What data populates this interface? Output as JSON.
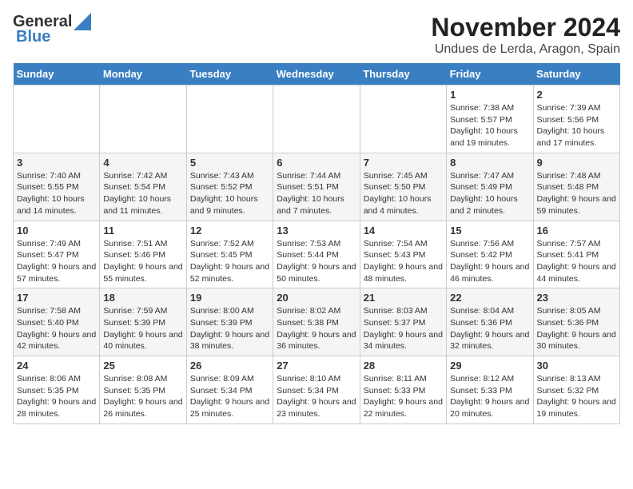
{
  "logo": {
    "line1": "General",
    "line2": "Blue"
  },
  "title": "November 2024",
  "subtitle": "Undues de Lerda, Aragon, Spain",
  "weekdays": [
    "Sunday",
    "Monday",
    "Tuesday",
    "Wednesday",
    "Thursday",
    "Friday",
    "Saturday"
  ],
  "weeks": [
    [
      {
        "day": "",
        "info": ""
      },
      {
        "day": "",
        "info": ""
      },
      {
        "day": "",
        "info": ""
      },
      {
        "day": "",
        "info": ""
      },
      {
        "day": "",
        "info": ""
      },
      {
        "day": "1",
        "info": "Sunrise: 7:38 AM\nSunset: 5:57 PM\nDaylight: 10 hours and 19 minutes."
      },
      {
        "day": "2",
        "info": "Sunrise: 7:39 AM\nSunset: 5:56 PM\nDaylight: 10 hours and 17 minutes."
      }
    ],
    [
      {
        "day": "3",
        "info": "Sunrise: 7:40 AM\nSunset: 5:55 PM\nDaylight: 10 hours and 14 minutes."
      },
      {
        "day": "4",
        "info": "Sunrise: 7:42 AM\nSunset: 5:54 PM\nDaylight: 10 hours and 11 minutes."
      },
      {
        "day": "5",
        "info": "Sunrise: 7:43 AM\nSunset: 5:52 PM\nDaylight: 10 hours and 9 minutes."
      },
      {
        "day": "6",
        "info": "Sunrise: 7:44 AM\nSunset: 5:51 PM\nDaylight: 10 hours and 7 minutes."
      },
      {
        "day": "7",
        "info": "Sunrise: 7:45 AM\nSunset: 5:50 PM\nDaylight: 10 hours and 4 minutes."
      },
      {
        "day": "8",
        "info": "Sunrise: 7:47 AM\nSunset: 5:49 PM\nDaylight: 10 hours and 2 minutes."
      },
      {
        "day": "9",
        "info": "Sunrise: 7:48 AM\nSunset: 5:48 PM\nDaylight: 9 hours and 59 minutes."
      }
    ],
    [
      {
        "day": "10",
        "info": "Sunrise: 7:49 AM\nSunset: 5:47 PM\nDaylight: 9 hours and 57 minutes."
      },
      {
        "day": "11",
        "info": "Sunrise: 7:51 AM\nSunset: 5:46 PM\nDaylight: 9 hours and 55 minutes."
      },
      {
        "day": "12",
        "info": "Sunrise: 7:52 AM\nSunset: 5:45 PM\nDaylight: 9 hours and 52 minutes."
      },
      {
        "day": "13",
        "info": "Sunrise: 7:53 AM\nSunset: 5:44 PM\nDaylight: 9 hours and 50 minutes."
      },
      {
        "day": "14",
        "info": "Sunrise: 7:54 AM\nSunset: 5:43 PM\nDaylight: 9 hours and 48 minutes."
      },
      {
        "day": "15",
        "info": "Sunrise: 7:56 AM\nSunset: 5:42 PM\nDaylight: 9 hours and 46 minutes."
      },
      {
        "day": "16",
        "info": "Sunrise: 7:57 AM\nSunset: 5:41 PM\nDaylight: 9 hours and 44 minutes."
      }
    ],
    [
      {
        "day": "17",
        "info": "Sunrise: 7:58 AM\nSunset: 5:40 PM\nDaylight: 9 hours and 42 minutes."
      },
      {
        "day": "18",
        "info": "Sunrise: 7:59 AM\nSunset: 5:39 PM\nDaylight: 9 hours and 40 minutes."
      },
      {
        "day": "19",
        "info": "Sunrise: 8:00 AM\nSunset: 5:39 PM\nDaylight: 9 hours and 38 minutes."
      },
      {
        "day": "20",
        "info": "Sunrise: 8:02 AM\nSunset: 5:38 PM\nDaylight: 9 hours and 36 minutes."
      },
      {
        "day": "21",
        "info": "Sunrise: 8:03 AM\nSunset: 5:37 PM\nDaylight: 9 hours and 34 minutes."
      },
      {
        "day": "22",
        "info": "Sunrise: 8:04 AM\nSunset: 5:36 PM\nDaylight: 9 hours and 32 minutes."
      },
      {
        "day": "23",
        "info": "Sunrise: 8:05 AM\nSunset: 5:36 PM\nDaylight: 9 hours and 30 minutes."
      }
    ],
    [
      {
        "day": "24",
        "info": "Sunrise: 8:06 AM\nSunset: 5:35 PM\nDaylight: 9 hours and 28 minutes."
      },
      {
        "day": "25",
        "info": "Sunrise: 8:08 AM\nSunset: 5:35 PM\nDaylight: 9 hours and 26 minutes."
      },
      {
        "day": "26",
        "info": "Sunrise: 8:09 AM\nSunset: 5:34 PM\nDaylight: 9 hours and 25 minutes."
      },
      {
        "day": "27",
        "info": "Sunrise: 8:10 AM\nSunset: 5:34 PM\nDaylight: 9 hours and 23 minutes."
      },
      {
        "day": "28",
        "info": "Sunrise: 8:11 AM\nSunset: 5:33 PM\nDaylight: 9 hours and 22 minutes."
      },
      {
        "day": "29",
        "info": "Sunrise: 8:12 AM\nSunset: 5:33 PM\nDaylight: 9 hours and 20 minutes."
      },
      {
        "day": "30",
        "info": "Sunrise: 8:13 AM\nSunset: 5:32 PM\nDaylight: 9 hours and 19 minutes."
      }
    ]
  ]
}
